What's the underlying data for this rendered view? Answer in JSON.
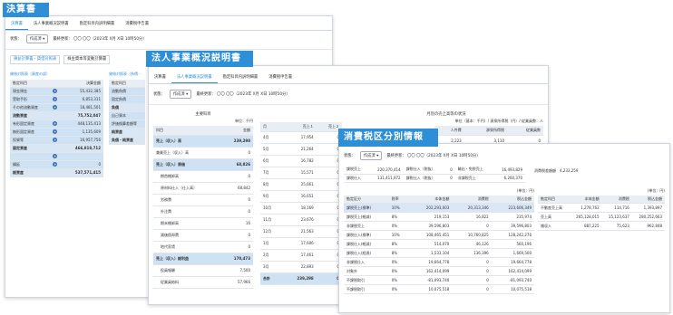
{
  "win1": {
    "banner": "決算書",
    "tabs": [
      "決算書",
      "法人事業概況説明書",
      "勘定科目内訳明細書",
      "消費税申告書"
    ],
    "status_label": "状態：",
    "status_value": "作成済",
    "updated": "最終更新： 〇〇 〇〇（2023年 X月 X日 10時50分）",
    "subtabs": [
      "損益計算書・貸借対照表",
      "株主資本等変動計算書"
    ],
    "bs_title": "貸借対照表（資産の部）",
    "bs_title2": "貸借対照表（負債・",
    "bs_header": [
      "勘定科目",
      "",
      "決算金額"
    ],
    "bs_rows": [
      [
        "現金預金",
        "+",
        "55,432,385"
      ],
      [
        "受取手形",
        "+",
        "6,853,311"
      ],
      [
        "その他流動資産",
        "+",
        "18,481,501"
      ],
      [
        "流動資産",
        "",
        "75,752,047"
      ],
      [
        "有形固定資産",
        "+",
        "448,135,413"
      ],
      [
        "無形固定資産",
        "+",
        "1,135,609"
      ],
      [
        "投資等",
        "+",
        "16,957,756"
      ],
      [
        "固定資産",
        "",
        "466,818,712"
      ],
      [
        "",
        "+",
        ""
      ],
      [
        "繰延",
        "+",
        "0"
      ],
      [
        "総資産",
        "",
        "537,571,415"
      ]
    ],
    "bs2_rows": [
      "流動負債",
      "固定負債",
      "負債",
      "自己資本",
      "評価換算差額等",
      "純資産",
      "負債・純資産"
    ]
  },
  "win2": {
    "banner": "法人事業概況説明書",
    "tabs": [
      "決算書",
      "法人事業概況説明書",
      "勘定科目内訳明細書",
      "消費税申告書"
    ],
    "status_label": "状態：",
    "status_value": "作成済",
    "updated": "最終更新： 〇〇 〇〇（2023年 X月 X日 10時50分）",
    "main_title": "主要科目",
    "unit": "単位：千円",
    "main_header": [
      "科目",
      "金額"
    ],
    "main_rows": [
      [
        "売上（収入）高",
        "239,298"
      ],
      [
        "兼業売上（収入）高",
        "0"
      ],
      [
        "売上（収入）原価",
        "68,826"
      ],
      [
        "期首棚卸高",
        "0"
      ],
      [
        "原材料仕入（仕入高）",
        "68,842"
      ],
      [
        "労務費",
        "0"
      ],
      [
        "外注費",
        "0"
      ],
      [
        "期末棚卸高",
        "16"
      ],
      [
        "減価償却費",
        "0"
      ],
      [
        "地代家賃",
        "0"
      ],
      [
        "売上（収入）総利益",
        "170,473"
      ],
      [
        "役員報酬",
        "7,500"
      ],
      [
        "従業員給料",
        "57,966"
      ]
    ],
    "monthly_title": "月別の売上高等の状況",
    "monthly_unit": "単位（基本：千円）/ 源泉所得税（円）/ 従業員数：人",
    "monthly_header": [
      "月",
      "売上１",
      "売上２"
    ],
    "monthly_rows": [
      [
        "4月",
        "17,954",
        "0"
      ],
      [
        "5月",
        "21,264",
        "0"
      ],
      [
        "6月",
        "16,782",
        "0"
      ],
      [
        "7月",
        "15,571",
        "0"
      ],
      [
        "8月",
        "25,661",
        "0"
      ],
      [
        "9月",
        "16,651",
        "0"
      ],
      [
        "10月",
        "18,169",
        "0"
      ],
      [
        "11月",
        "23,676",
        "0"
      ],
      [
        "12月",
        "21,563",
        "0"
      ],
      [
        "1月",
        "17,606",
        "0"
      ],
      [
        "2月",
        "17,461",
        "0"
      ],
      [
        "3月",
        "22,893",
        "0"
      ],
      [
        "合計",
        "239,298",
        "0"
      ]
    ],
    "right_header": [
      "人件費",
      "源泉所得税",
      "従業員数"
    ],
    "right_row": [
      "2,223",
      "3,110",
      "0"
    ]
  },
  "win3": {
    "banner": "消費税区分別情報",
    "status_label": "状態：",
    "status_value": "作成済",
    "updated": "最終更新： 〇〇 〇〇（2023年 X月 X日 10時50分）",
    "summary": [
      [
        "課税売上",
        "220,370,414",
        "課税仕入（税抜）",
        "0",
        "輸出・免税売上",
        "16,493,829"
      ],
      [
        "課税仕入",
        "131,411,972",
        "課税仕入（税抜）",
        "0",
        "非課税売上",
        "6,260,370"
      ]
    ],
    "summary_right": [
      "消費税差額額",
      "4,233,259"
    ],
    "unit": "(単位：円)",
    "left_header": [
      "勘定区分",
      "税率",
      "本体金額",
      "消費税",
      "税込金額"
    ],
    "left_rows": [
      [
        "課税売上(標準)",
        "10%",
        "202,293,003",
        "20,313,346",
        "223,606,349"
      ],
      [
        "課税売上(軽減)",
        "8%",
        "219,153",
        "16,822",
        "235,974"
      ],
      [
        "非課税売上",
        "0%",
        "39,596,803",
        "0",
        "39,596,803"
      ],
      [
        "課税仕入(標準)",
        "10%",
        "108,465,451",
        "10,760,825",
        "128,242,276"
      ],
      [
        "課税仕入(軽減)",
        "8%",
        "514,070",
        "46,126",
        "560,196"
      ],
      [
        "課税仕入(経過)",
        "8%",
        "1,533,104",
        "136,396",
        "1,669,500"
      ],
      [
        "非課税仕入",
        "0%",
        "19,664,778",
        "0",
        "19,664,778"
      ],
      [
        "対象外",
        "0%",
        "162,414,099",
        "0",
        "162,414,099"
      ],
      [
        "不課税取引",
        "0%",
        "-81,093,740",
        "0",
        "-81,093,740"
      ],
      [
        "不課税取引",
        "0%",
        "10,075,518",
        "0",
        "10,075,518"
      ]
    ],
    "right_header": [
      "勘定科目",
      "本体金額",
      "消費税",
      "税込金額"
    ],
    "right_rows": [
      [
        "不動産売上高",
        "1,278,762",
        "114,716",
        "1,393,897"
      ],
      [
        "売上高",
        "265,128,015",
        "15,123,637",
        "280,252,663"
      ],
      [
        "雑収入",
        "887,225",
        "75,623",
        "962,848"
      ]
    ]
  }
}
